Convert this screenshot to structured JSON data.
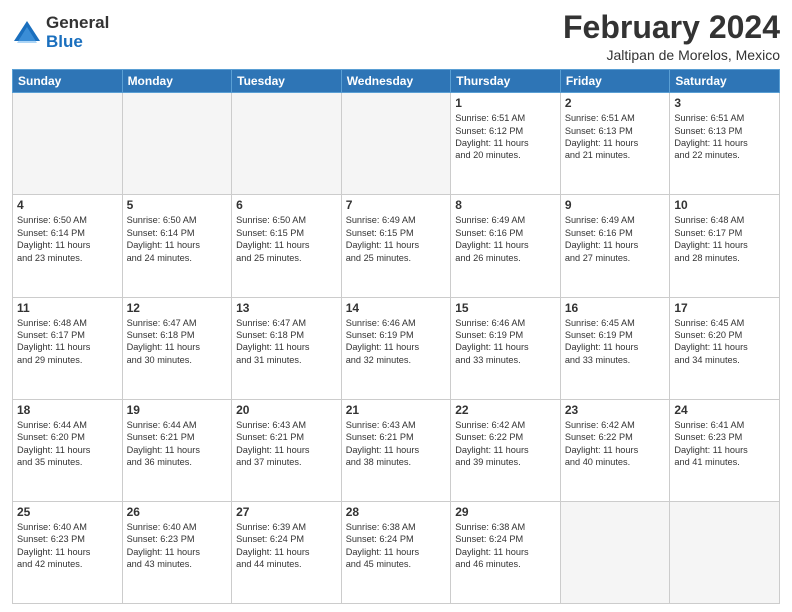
{
  "header": {
    "logo": {
      "general": "General",
      "blue": "Blue"
    },
    "title": "February 2024",
    "location": "Jaltipan de Morelos, Mexico"
  },
  "days_of_week": [
    "Sunday",
    "Monday",
    "Tuesday",
    "Wednesday",
    "Thursday",
    "Friday",
    "Saturday"
  ],
  "weeks": [
    [
      {
        "day": "",
        "info": ""
      },
      {
        "day": "",
        "info": ""
      },
      {
        "day": "",
        "info": ""
      },
      {
        "day": "",
        "info": ""
      },
      {
        "day": "1",
        "info": "Sunrise: 6:51 AM\nSunset: 6:12 PM\nDaylight: 11 hours\nand 20 minutes."
      },
      {
        "day": "2",
        "info": "Sunrise: 6:51 AM\nSunset: 6:13 PM\nDaylight: 11 hours\nand 21 minutes."
      },
      {
        "day": "3",
        "info": "Sunrise: 6:51 AM\nSunset: 6:13 PM\nDaylight: 11 hours\nand 22 minutes."
      }
    ],
    [
      {
        "day": "4",
        "info": "Sunrise: 6:50 AM\nSunset: 6:14 PM\nDaylight: 11 hours\nand 23 minutes."
      },
      {
        "day": "5",
        "info": "Sunrise: 6:50 AM\nSunset: 6:14 PM\nDaylight: 11 hours\nand 24 minutes."
      },
      {
        "day": "6",
        "info": "Sunrise: 6:50 AM\nSunset: 6:15 PM\nDaylight: 11 hours\nand 25 minutes."
      },
      {
        "day": "7",
        "info": "Sunrise: 6:49 AM\nSunset: 6:15 PM\nDaylight: 11 hours\nand 25 minutes."
      },
      {
        "day": "8",
        "info": "Sunrise: 6:49 AM\nSunset: 6:16 PM\nDaylight: 11 hours\nand 26 minutes."
      },
      {
        "day": "9",
        "info": "Sunrise: 6:49 AM\nSunset: 6:16 PM\nDaylight: 11 hours\nand 27 minutes."
      },
      {
        "day": "10",
        "info": "Sunrise: 6:48 AM\nSunset: 6:17 PM\nDaylight: 11 hours\nand 28 minutes."
      }
    ],
    [
      {
        "day": "11",
        "info": "Sunrise: 6:48 AM\nSunset: 6:17 PM\nDaylight: 11 hours\nand 29 minutes."
      },
      {
        "day": "12",
        "info": "Sunrise: 6:47 AM\nSunset: 6:18 PM\nDaylight: 11 hours\nand 30 minutes."
      },
      {
        "day": "13",
        "info": "Sunrise: 6:47 AM\nSunset: 6:18 PM\nDaylight: 11 hours\nand 31 minutes."
      },
      {
        "day": "14",
        "info": "Sunrise: 6:46 AM\nSunset: 6:19 PM\nDaylight: 11 hours\nand 32 minutes."
      },
      {
        "day": "15",
        "info": "Sunrise: 6:46 AM\nSunset: 6:19 PM\nDaylight: 11 hours\nand 33 minutes."
      },
      {
        "day": "16",
        "info": "Sunrise: 6:45 AM\nSunset: 6:19 PM\nDaylight: 11 hours\nand 33 minutes."
      },
      {
        "day": "17",
        "info": "Sunrise: 6:45 AM\nSunset: 6:20 PM\nDaylight: 11 hours\nand 34 minutes."
      }
    ],
    [
      {
        "day": "18",
        "info": "Sunrise: 6:44 AM\nSunset: 6:20 PM\nDaylight: 11 hours\nand 35 minutes."
      },
      {
        "day": "19",
        "info": "Sunrise: 6:44 AM\nSunset: 6:21 PM\nDaylight: 11 hours\nand 36 minutes."
      },
      {
        "day": "20",
        "info": "Sunrise: 6:43 AM\nSunset: 6:21 PM\nDaylight: 11 hours\nand 37 minutes."
      },
      {
        "day": "21",
        "info": "Sunrise: 6:43 AM\nSunset: 6:21 PM\nDaylight: 11 hours\nand 38 minutes."
      },
      {
        "day": "22",
        "info": "Sunrise: 6:42 AM\nSunset: 6:22 PM\nDaylight: 11 hours\nand 39 minutes."
      },
      {
        "day": "23",
        "info": "Sunrise: 6:42 AM\nSunset: 6:22 PM\nDaylight: 11 hours\nand 40 minutes."
      },
      {
        "day": "24",
        "info": "Sunrise: 6:41 AM\nSunset: 6:23 PM\nDaylight: 11 hours\nand 41 minutes."
      }
    ],
    [
      {
        "day": "25",
        "info": "Sunrise: 6:40 AM\nSunset: 6:23 PM\nDaylight: 11 hours\nand 42 minutes."
      },
      {
        "day": "26",
        "info": "Sunrise: 6:40 AM\nSunset: 6:23 PM\nDaylight: 11 hours\nand 43 minutes."
      },
      {
        "day": "27",
        "info": "Sunrise: 6:39 AM\nSunset: 6:24 PM\nDaylight: 11 hours\nand 44 minutes."
      },
      {
        "day": "28",
        "info": "Sunrise: 6:38 AM\nSunset: 6:24 PM\nDaylight: 11 hours\nand 45 minutes."
      },
      {
        "day": "29",
        "info": "Sunrise: 6:38 AM\nSunset: 6:24 PM\nDaylight: 11 hours\nand 46 minutes."
      },
      {
        "day": "",
        "info": ""
      },
      {
        "day": "",
        "info": ""
      }
    ]
  ]
}
